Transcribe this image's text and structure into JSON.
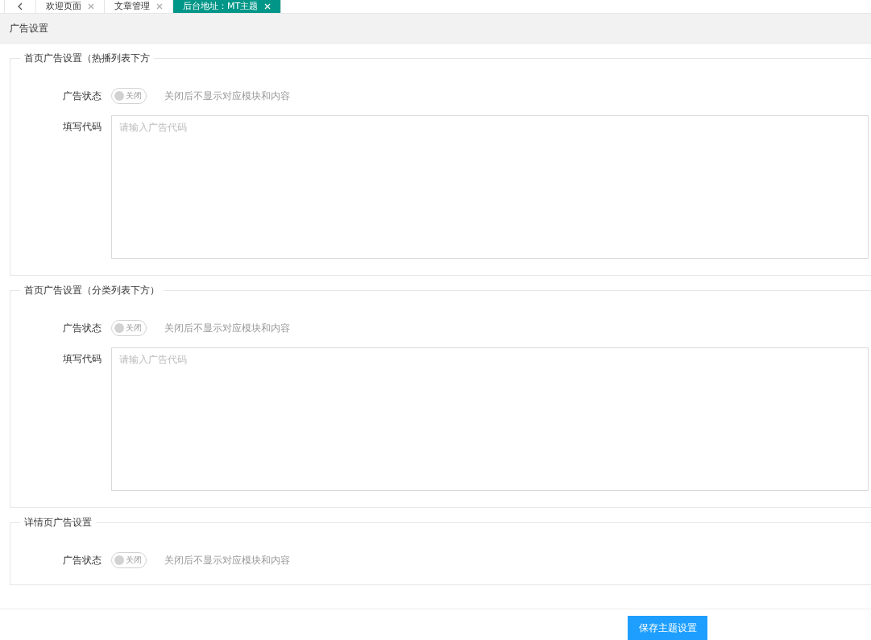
{
  "tabs": [
    {
      "label": "欢迎页面",
      "selected": false
    },
    {
      "label": "文章管理",
      "selected": false
    },
    {
      "label": "后台地址：MT主题",
      "selected": true
    }
  ],
  "panel": {
    "title": "广告设置"
  },
  "sections": [
    {
      "title": "首页广告设置（热播列表下方",
      "status_label": "广告状态",
      "switch": {
        "on": false,
        "text": "关闭"
      },
      "hint": "关闭后不显示对应模块和内容",
      "code_label": "填写代码",
      "placeholder": "请输入广告代码"
    },
    {
      "title": "首页广告设置（分类列表下方）",
      "status_label": "广告状态",
      "switch": {
        "on": false,
        "text": "关闭"
      },
      "hint": "关闭后不显示对应模块和内容",
      "code_label": "填写代码",
      "placeholder": "请输入广告代码"
    },
    {
      "title": "详情页广告设置",
      "status_label": "广告状态",
      "switch": {
        "on": false,
        "text": "关闭"
      },
      "hint": "关闭后不显示对应模块和内容"
    }
  ],
  "save_button": "保存主题设置"
}
